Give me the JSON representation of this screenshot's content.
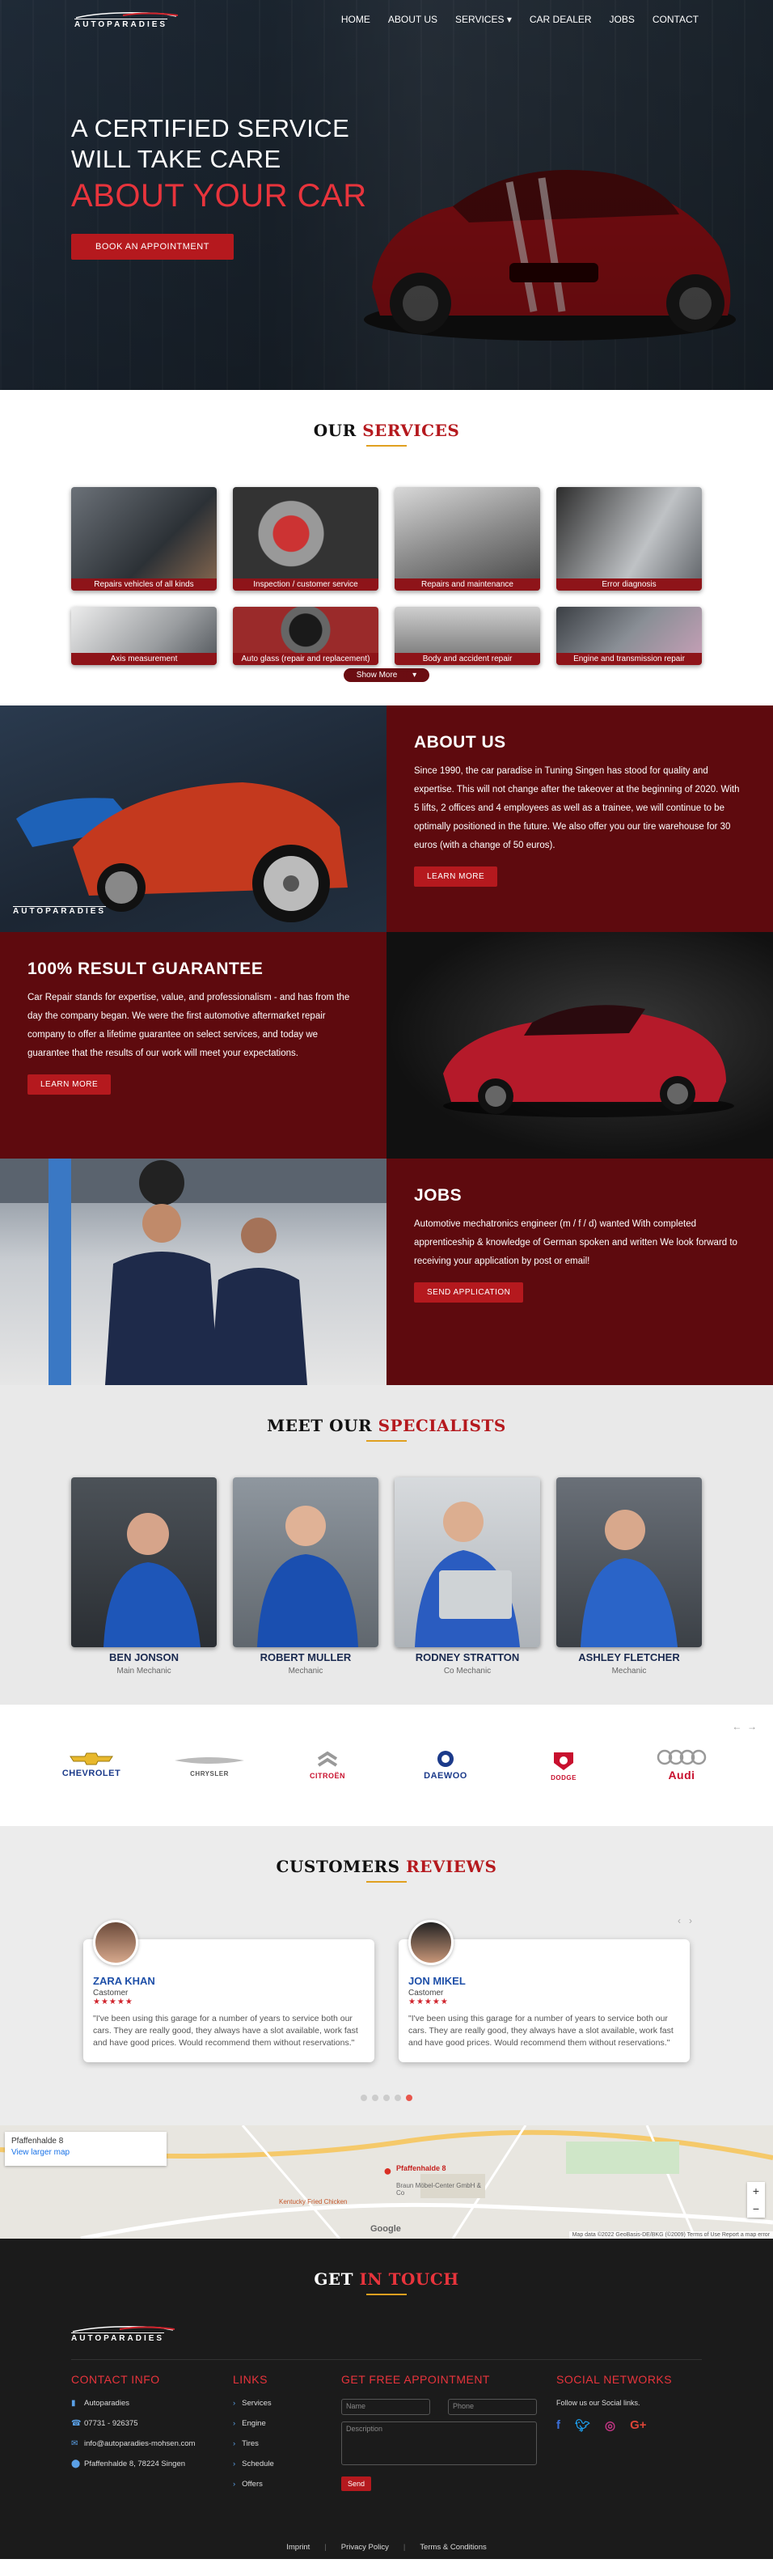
{
  "nav": {
    "logo_text": "AUTOPARADIES",
    "items": [
      "HOME",
      "ABOUT US",
      "SERVICES",
      "CAR DEALER",
      "JOBS",
      "CONTACT"
    ]
  },
  "hero": {
    "line1": "A CERTIFIED SERVICE",
    "line2": "WILL TAKE CARE",
    "line3": "ABOUT YOUR CAR",
    "button": "BOOK AN APPOINTMENT"
  },
  "services": {
    "title_a": "OUR",
    "title_b": "SERVICES",
    "items": [
      "Repairs vehicles of all kinds",
      "Inspection / customer service",
      "Repairs and maintenance",
      "Error diagnosis",
      "Axis measurement",
      "Auto glass (repair and replacement)",
      "Body and accident repair",
      "Engine and transmission repair"
    ],
    "show_more": "Show More"
  },
  "about": {
    "title": "ABOUT US",
    "text": "Since 1990, the car paradise in Tuning Singen has stood for quality and expertise. This will not change after the takeover at the beginning of 2020. With 5 lifts, 2 offices and 4 employees as well as a trainee, we will continue to be optimally positioned in the future. We also offer you our tire warehouse for 30 euros (with a change of 50 euros).",
    "button": "LEARN MORE",
    "image_logo": "AUTOPARADIES"
  },
  "guarantee": {
    "title": "100% RESULT GUARANTEE",
    "text": "Car Repair stands for expertise, value, and professionalism - and has from the day the company began. We were the first automotive aftermarket repair company to offer a lifetime guarantee on select services, and today we guarantee that the results of our work will meet your expectations.",
    "button": "LEARN MORE"
  },
  "jobs": {
    "title": "JOBS",
    "text": "Automotive mechatronics engineer (m / f / d) wanted With completed apprenticeship & knowledge of German spoken and written We look forward to receiving your application by post or email!",
    "button": "SEND APPLICATION"
  },
  "specialists": {
    "title_a": "MEET OUR",
    "title_b": "SPECIALISTS",
    "people": [
      {
        "name": "BEN JONSON",
        "role": "Main Mechanic"
      },
      {
        "name": "ROBERT MULLER",
        "role": "Mechanic"
      },
      {
        "name": "RODNEY STRATTON",
        "role": "Co Mechanic"
      },
      {
        "name": "ASHLEY FLETCHER",
        "role": "Mechanic"
      }
    ]
  },
  "brands": [
    "CHEVROLET",
    "CHRYSLER",
    "CITROËN",
    "DAEWOO",
    "DODGE",
    "Audi"
  ],
  "reviews": {
    "title_a": "CUSTOMERS",
    "title_b": "REVIEWS",
    "items": [
      {
        "name": "ZARA KHAN",
        "role": "Castomer",
        "text": "\"I've been using this garage for a number of years to service both our cars. They are really good, they always have a slot available, work fast and have good prices. Would recommend them without reservations.\""
      },
      {
        "name": "JON MIKEL",
        "role": "Castomer",
        "text": "\"I've been using this garage for a number of years to service both our cars. They are really good, they always have a slot available, work fast and have good prices. Would recommend them without reservations.\""
      }
    ]
  },
  "map": {
    "place": "Pfaffenhalde 8",
    "link": "View larger map",
    "pin_label": "Pfaffenhalde 8",
    "store": "Braun Möbel-Center GmbH & Co",
    "kfc": "Kentucky Fried Chicken",
    "google": "Google",
    "footer_text": "Map data ©2022 GeoBasis-DE/BKG (©2009)   Terms of Use   Report a map error"
  },
  "footer": {
    "title_a": "GET",
    "title_b": "IN TOUCH",
    "logo_text": "AUTOPARADIES",
    "contact": {
      "heading": "CONTACT INFO",
      "company": "Autoparadies",
      "phone": "07731 - 926375",
      "email": "info@autoparadies-mohsen.com",
      "address": "Pfaffenhalde 8, 78224 Singen"
    },
    "links": {
      "heading": "LINKS",
      "items": [
        "Services",
        "Engine",
        "Tires",
        "Schedule",
        "Offers"
      ]
    },
    "appointment": {
      "heading": "GET FREE APPOINTMENT",
      "name_ph": "Name",
      "phone_ph": "Phone",
      "desc_ph": "Description",
      "button": "Send"
    },
    "social": {
      "heading": "SOCIAL NETWORKS",
      "text": "Follow us our Social links."
    },
    "bottom": [
      "Imprint",
      "Privacy Policy",
      "Terms & Conditions"
    ]
  },
  "colors": {
    "accent": "#b5191e",
    "dark_red": "#5e0a0e",
    "title_gold": "#e0a020",
    "footer_bg": "#1b1b1b"
  }
}
